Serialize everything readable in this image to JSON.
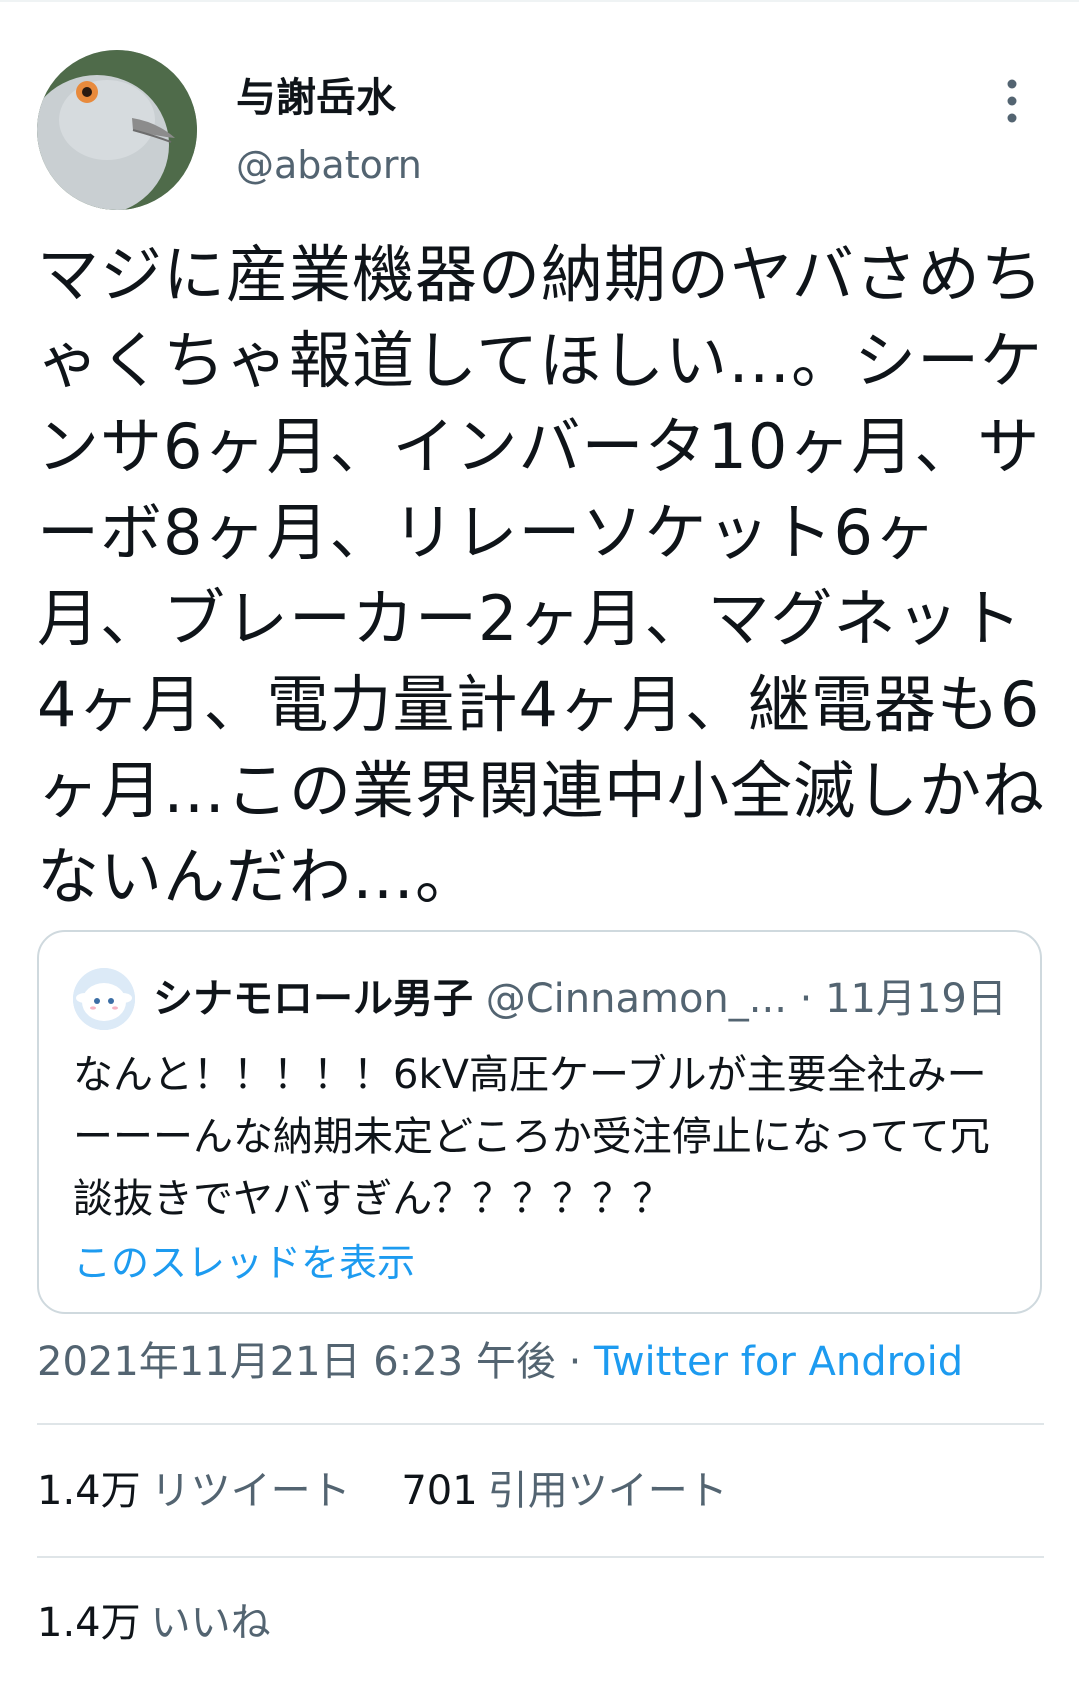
{
  "tweet": {
    "display_name": "与謝岳水",
    "handle": "@abatorn",
    "avatar_icon": "pigeon-avatar-icon",
    "text": "マジに産業機器の納期のヤバさめちゃくちゃ報道してほしい…。シーケンサ6ヶ月、インバータ10ヶ月、サーボ8ヶ月、リレーソケット6ヶ月、ブレーカー2ヶ月、マグネット4ヶ月、電力量計4ヶ月、継電器も6ヶ月…この業界関連中小全滅しかねないんだわ…。"
  },
  "quote": {
    "name": "シナモロール男子",
    "handle": "@Cinnamon_...",
    "separator": " · ",
    "date": "11月19日",
    "text": "なんと！！！！！6kV高圧ケーブルが主要全社みーーーーんな納期未定どころか受注停止になってて冗談抜きでヤバすぎん？？？？？？",
    "show_thread": "このスレッドを表示"
  },
  "meta": {
    "timestamp": "2021年11月21日 6:23 午後",
    "separator": " · ",
    "source": "Twitter for Android"
  },
  "stats": {
    "retweets_count": "1.4万",
    "retweets_label": "リツイート",
    "quotes_count": "701",
    "quotes_label": "引用ツイート",
    "likes_count": "1.4万",
    "likes_label": "いいね"
  },
  "colors": {
    "link_blue": "#1d9bf0",
    "secondary_text": "#536471",
    "primary_text": "#0f1419",
    "border": "#cfd9de"
  }
}
